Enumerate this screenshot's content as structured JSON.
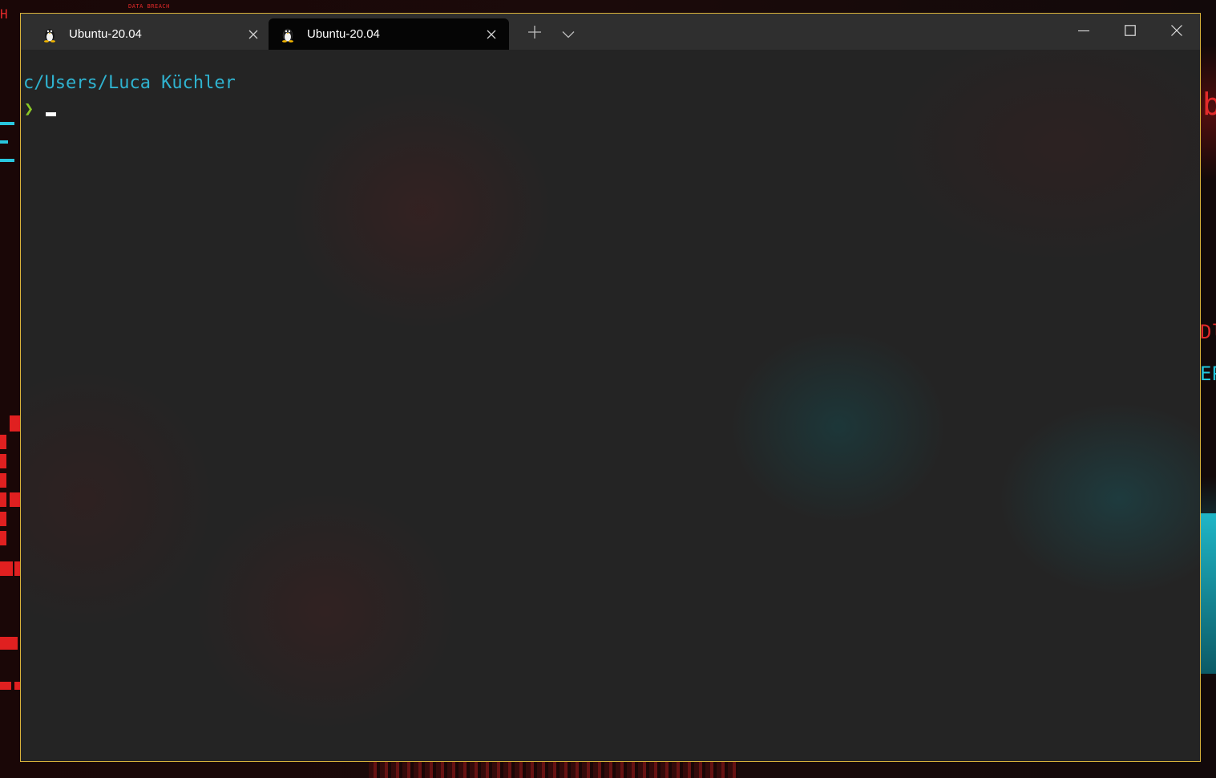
{
  "wallpaper": {
    "top_left_text": "H",
    "banner_text": "DATA BREACH",
    "right_glyph_1": "b",
    "right_glyph_2": "Dl",
    "right_glyph_3": "EP"
  },
  "tabs": [
    {
      "label": "Ubuntu-20.04",
      "icon": "linux-penguin-icon",
      "active": false
    },
    {
      "label": "Ubuntu-20.04",
      "icon": "linux-penguin-icon",
      "active": true
    }
  ],
  "terminal": {
    "cwd_path": "c/Users/Luca Küchler",
    "prompt_symbol": "❯"
  },
  "colors": {
    "window_border": "#d9b23a",
    "path_color": "#2fb3d0",
    "prompt_color": "#8ac926",
    "active_tab_bg": "#050505",
    "titlebar_bg": "#2f2f2f"
  }
}
